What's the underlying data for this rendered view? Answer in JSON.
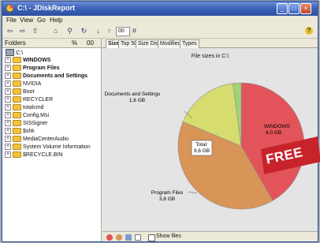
{
  "window": {
    "title": "C:\\ - JDiskReport"
  },
  "menu": {
    "items": [
      "File",
      "View",
      "Go",
      "Help"
    ]
  },
  "toolbar": {
    "field_value": "00",
    "hash": "#",
    "help": "?"
  },
  "folders_panel": {
    "header_label": "Folders",
    "header_pct": "%",
    "header_size": "00",
    "root_label": "C:\\",
    "items": [
      {
        "name": "WINDOWS",
        "bold": true,
        "type": "folder"
      },
      {
        "name": "Program Files",
        "bold": true,
        "type": "folder"
      },
      {
        "name": "Documents and Settings",
        "bold": true,
        "type": "folder"
      },
      {
        "name": "NVIDIA",
        "bold": false,
        "type": "folder"
      },
      {
        "name": "Boot",
        "bold": false,
        "type": "folder"
      },
      {
        "name": "RECYCLER",
        "bold": false,
        "type": "folder"
      },
      {
        "name": "totalcmd",
        "bold": false,
        "type": "folder"
      },
      {
        "name": "Config.Msi",
        "bold": false,
        "type": "folder"
      },
      {
        "name": "SISSigner",
        "bold": false,
        "type": "folder"
      },
      {
        "name": "$shk",
        "bold": false,
        "type": "folder"
      },
      {
        "name": "MediaCenterAudio",
        "bold": false,
        "type": "folder"
      },
      {
        "name": "System Volume Information",
        "bold": false,
        "type": "folder"
      },
      {
        "name": "$RECYCLE.BIN",
        "bold": false,
        "type": "folder"
      }
    ]
  },
  "tabs": [
    "Size",
    "Top 50",
    "Size Dist",
    "Modified",
    "Types"
  ],
  "active_tab": "Size",
  "chart_data": {
    "type": "pie",
    "title": "File sizes in C:\\",
    "center_label": "Total:",
    "center_value": "9,6 GB",
    "slices": [
      {
        "name": "WINDOWS",
        "value": 4.0,
        "label": "4,0 GB",
        "color": "#e2545a"
      },
      {
        "name": "Program Files",
        "value": 3.8,
        "label": "3,8 GB",
        "color": "#d99458"
      },
      {
        "name": "Documents and Settings",
        "value": 1.6,
        "label": "1,6 GB",
        "color": "#d6dd6e"
      },
      {
        "name": "",
        "value": 0.2,
        "label": "",
        "color": "#9fd37a"
      }
    ]
  },
  "bottom_bar": {
    "checkbox_label": "Show files"
  },
  "badge": {
    "text": "FREE",
    "color": "#c8232b"
  }
}
